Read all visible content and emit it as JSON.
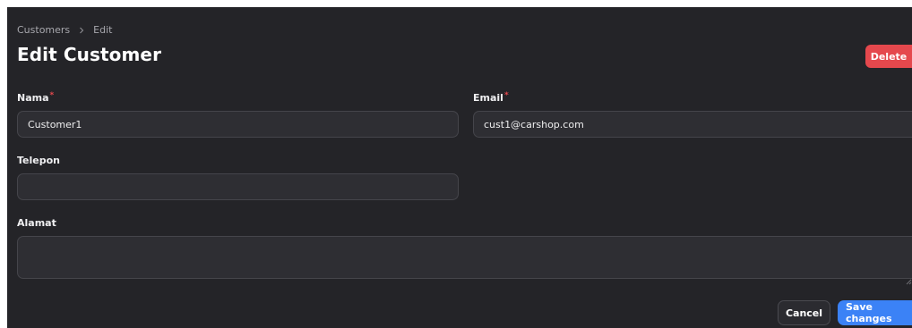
{
  "breadcrumb": {
    "items": [
      "Customers",
      "Edit"
    ]
  },
  "header": {
    "title": "Edit Customer",
    "delete_label": "Delete"
  },
  "form": {
    "nama": {
      "label": "Nama",
      "required_mark": "*",
      "value": "Customer1"
    },
    "email": {
      "label": "Email",
      "required_mark": "*",
      "value": "cust1@carshop.com"
    },
    "telepon": {
      "label": "Telepon",
      "value": ""
    },
    "alamat": {
      "label": "Alamat",
      "value": ""
    }
  },
  "actions": {
    "cancel_label": "Cancel",
    "save_label": "Save changes"
  },
  "colors": {
    "background": "#242428",
    "danger": "#e5484d",
    "primary": "#3b82f6"
  },
  "icons": {
    "breadcrumb_separator": "chevron-right-icon",
    "textarea_resize": "resize-grip-icon"
  }
}
